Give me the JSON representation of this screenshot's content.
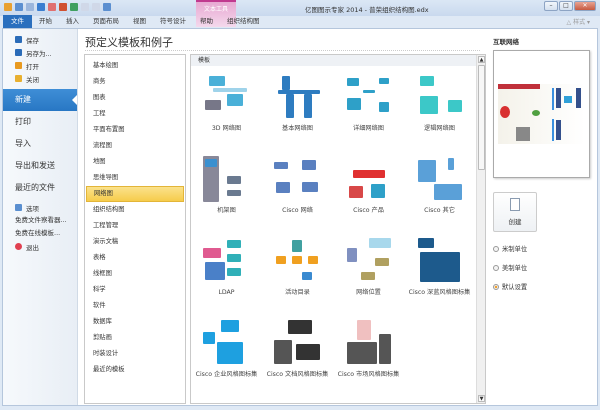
{
  "window": {
    "title": "亿图图示专家 2014 - 普荣组织结构图.edx",
    "context_tab": "文本工具",
    "min": "–",
    "max": "□",
    "close": "✕"
  },
  "ribbon": {
    "tabs": [
      "文件",
      "开始",
      "插入",
      "页面布局",
      "视图",
      "符号设计",
      "帮助",
      "组织结构图"
    ],
    "style_label": "△ 样式 ▾"
  },
  "nav": {
    "top_items": [
      {
        "label": "保存",
        "icon": "save-icon",
        "color": "#2b6cb8"
      },
      {
        "label": "另存为...",
        "icon": "save-as-icon",
        "color": "#2b6cb8"
      },
      {
        "label": "打开",
        "icon": "open-icon",
        "color": "#e89a20"
      },
      {
        "label": "关闭",
        "icon": "close-folder-icon",
        "color": "#e8b030"
      }
    ],
    "big_items": [
      "新建",
      "打印",
      "导入",
      "导出和发送",
      "最近的文件"
    ],
    "selected": "新建",
    "bottom_items": [
      {
        "label": "选项",
        "icon": "options-icon",
        "color": "#5a8fd0"
      },
      {
        "label": "免费文件察看器...",
        "icon": "",
        "color": ""
      },
      {
        "label": "免费在线模板...",
        "icon": "",
        "color": ""
      },
      {
        "label": "退出",
        "icon": "exit-icon",
        "color": "#e04050"
      }
    ]
  },
  "page_title": "预定义模板和例子",
  "categories": {
    "items": [
      "基本绘图",
      "商务",
      "图表",
      "工程",
      "平面布置图",
      "流程图",
      "地图",
      "思维导图",
      "网络图",
      "组织结构图",
      "工程管理",
      "演示文稿",
      "表格",
      "线框图",
      "科学",
      "软件",
      "数据库",
      "剪贴画",
      "时装设计",
      "最近的模板"
    ],
    "selected": "网络图"
  },
  "templates": {
    "header": "模板",
    "items": [
      "3D 网络图",
      "基本网络图",
      "详细网络图",
      "逻辑网络图",
      "机架图",
      "Cisco 网络",
      "Cisco 产品",
      "Cisco 其它",
      "LDAP",
      "活动目录",
      "网络位置",
      "Cisco 深蓝风格图标集",
      "Cisco 企业风格图标集",
      "Cisco 文档风格图标集",
      "Cisco 市场风格图标集"
    ]
  },
  "right": {
    "preview_title": "互联网络",
    "create_label": "创建",
    "units": [
      {
        "label": "米制单位",
        "checked": false
      },
      {
        "label": "美制单位",
        "checked": false
      },
      {
        "label": "默认设置",
        "checked": true
      }
    ]
  },
  "colors": {
    "accent": "#2a6fbe",
    "selection": "#f6cc4c",
    "network_blue": "#3aa0d8"
  }
}
